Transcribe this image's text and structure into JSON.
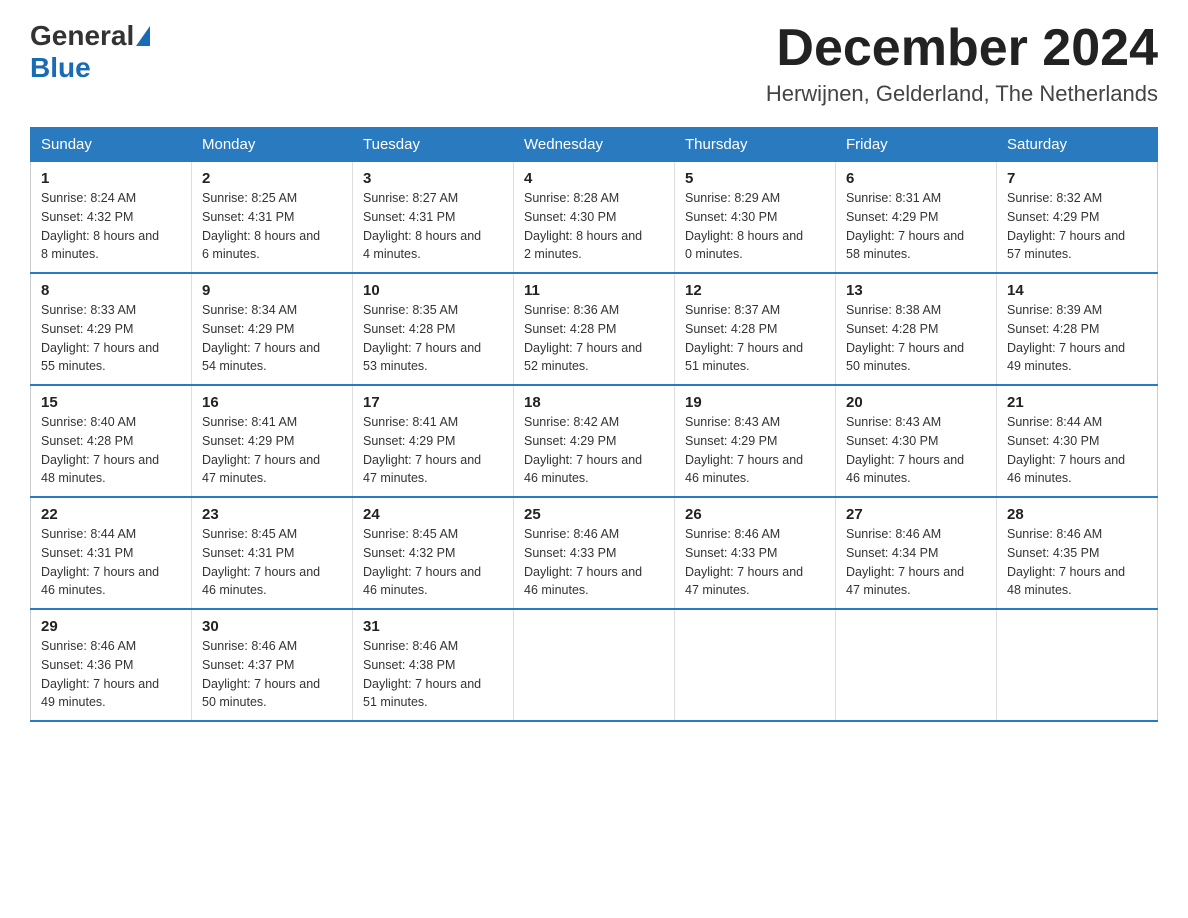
{
  "header": {
    "logo_general": "General",
    "logo_blue": "Blue",
    "month_title": "December 2024",
    "location": "Herwijnen, Gelderland, The Netherlands"
  },
  "days_of_week": [
    "Sunday",
    "Monday",
    "Tuesday",
    "Wednesday",
    "Thursday",
    "Friday",
    "Saturday"
  ],
  "weeks": [
    [
      {
        "day": "1",
        "sunrise": "8:24 AM",
        "sunset": "4:32 PM",
        "daylight": "8 hours and 8 minutes."
      },
      {
        "day": "2",
        "sunrise": "8:25 AM",
        "sunset": "4:31 PM",
        "daylight": "8 hours and 6 minutes."
      },
      {
        "day": "3",
        "sunrise": "8:27 AM",
        "sunset": "4:31 PM",
        "daylight": "8 hours and 4 minutes."
      },
      {
        "day": "4",
        "sunrise": "8:28 AM",
        "sunset": "4:30 PM",
        "daylight": "8 hours and 2 minutes."
      },
      {
        "day": "5",
        "sunrise": "8:29 AM",
        "sunset": "4:30 PM",
        "daylight": "8 hours and 0 minutes."
      },
      {
        "day": "6",
        "sunrise": "8:31 AM",
        "sunset": "4:29 PM",
        "daylight": "7 hours and 58 minutes."
      },
      {
        "day": "7",
        "sunrise": "8:32 AM",
        "sunset": "4:29 PM",
        "daylight": "7 hours and 57 minutes."
      }
    ],
    [
      {
        "day": "8",
        "sunrise": "8:33 AM",
        "sunset": "4:29 PM",
        "daylight": "7 hours and 55 minutes."
      },
      {
        "day": "9",
        "sunrise": "8:34 AM",
        "sunset": "4:29 PM",
        "daylight": "7 hours and 54 minutes."
      },
      {
        "day": "10",
        "sunrise": "8:35 AM",
        "sunset": "4:28 PM",
        "daylight": "7 hours and 53 minutes."
      },
      {
        "day": "11",
        "sunrise": "8:36 AM",
        "sunset": "4:28 PM",
        "daylight": "7 hours and 52 minutes."
      },
      {
        "day": "12",
        "sunrise": "8:37 AM",
        "sunset": "4:28 PM",
        "daylight": "7 hours and 51 minutes."
      },
      {
        "day": "13",
        "sunrise": "8:38 AM",
        "sunset": "4:28 PM",
        "daylight": "7 hours and 50 minutes."
      },
      {
        "day": "14",
        "sunrise": "8:39 AM",
        "sunset": "4:28 PM",
        "daylight": "7 hours and 49 minutes."
      }
    ],
    [
      {
        "day": "15",
        "sunrise": "8:40 AM",
        "sunset": "4:28 PM",
        "daylight": "7 hours and 48 minutes."
      },
      {
        "day": "16",
        "sunrise": "8:41 AM",
        "sunset": "4:29 PM",
        "daylight": "7 hours and 47 minutes."
      },
      {
        "day": "17",
        "sunrise": "8:41 AM",
        "sunset": "4:29 PM",
        "daylight": "7 hours and 47 minutes."
      },
      {
        "day": "18",
        "sunrise": "8:42 AM",
        "sunset": "4:29 PM",
        "daylight": "7 hours and 46 minutes."
      },
      {
        "day": "19",
        "sunrise": "8:43 AM",
        "sunset": "4:29 PM",
        "daylight": "7 hours and 46 minutes."
      },
      {
        "day": "20",
        "sunrise": "8:43 AM",
        "sunset": "4:30 PM",
        "daylight": "7 hours and 46 minutes."
      },
      {
        "day": "21",
        "sunrise": "8:44 AM",
        "sunset": "4:30 PM",
        "daylight": "7 hours and 46 minutes."
      }
    ],
    [
      {
        "day": "22",
        "sunrise": "8:44 AM",
        "sunset": "4:31 PM",
        "daylight": "7 hours and 46 minutes."
      },
      {
        "day": "23",
        "sunrise": "8:45 AM",
        "sunset": "4:31 PM",
        "daylight": "7 hours and 46 minutes."
      },
      {
        "day": "24",
        "sunrise": "8:45 AM",
        "sunset": "4:32 PM",
        "daylight": "7 hours and 46 minutes."
      },
      {
        "day": "25",
        "sunrise": "8:46 AM",
        "sunset": "4:33 PM",
        "daylight": "7 hours and 46 minutes."
      },
      {
        "day": "26",
        "sunrise": "8:46 AM",
        "sunset": "4:33 PM",
        "daylight": "7 hours and 47 minutes."
      },
      {
        "day": "27",
        "sunrise": "8:46 AM",
        "sunset": "4:34 PM",
        "daylight": "7 hours and 47 minutes."
      },
      {
        "day": "28",
        "sunrise": "8:46 AM",
        "sunset": "4:35 PM",
        "daylight": "7 hours and 48 minutes."
      }
    ],
    [
      {
        "day": "29",
        "sunrise": "8:46 AM",
        "sunset": "4:36 PM",
        "daylight": "7 hours and 49 minutes."
      },
      {
        "day": "30",
        "sunrise": "8:46 AM",
        "sunset": "4:37 PM",
        "daylight": "7 hours and 50 minutes."
      },
      {
        "day": "31",
        "sunrise": "8:46 AM",
        "sunset": "4:38 PM",
        "daylight": "7 hours and 51 minutes."
      },
      null,
      null,
      null,
      null
    ]
  ],
  "labels": {
    "sunrise": "Sunrise:",
    "sunset": "Sunset:",
    "daylight": "Daylight:"
  }
}
